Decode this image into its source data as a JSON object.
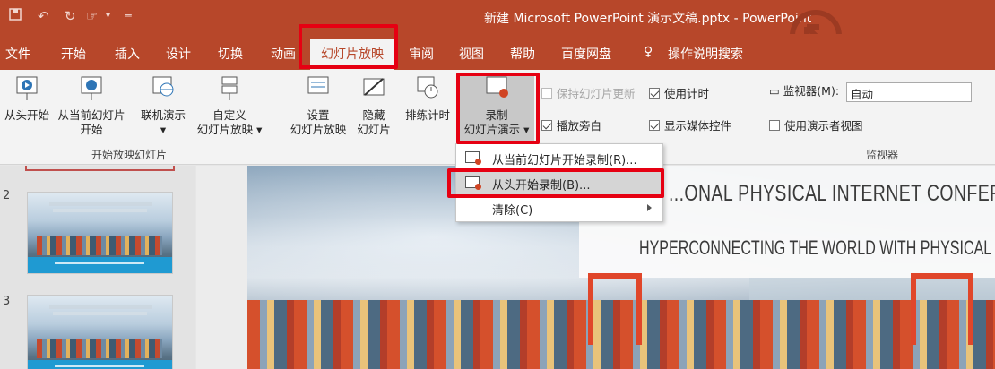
{
  "window": {
    "title": "新建 Microsoft PowerPoint 演示文稿.pptx  -  PowerPoint"
  },
  "quick_access": [
    "save-icon",
    "undo-icon",
    "redo-icon",
    "touch-mode-icon",
    "customize-icon"
  ],
  "tabs": [
    {
      "label": "文件"
    },
    {
      "label": "开始"
    },
    {
      "label": "插入"
    },
    {
      "label": "设计"
    },
    {
      "label": "切换"
    },
    {
      "label": "动画"
    },
    {
      "label": "幻灯片放映",
      "active": true
    },
    {
      "label": "审阅"
    },
    {
      "label": "视图"
    },
    {
      "label": "帮助"
    },
    {
      "label": "百度网盘"
    },
    {
      "label": "操作说明搜索"
    }
  ],
  "ribbon": {
    "group1": {
      "label": "开始放映幻灯片",
      "buttons": [
        {
          "line1": "从头开始",
          "line2": ""
        },
        {
          "line1": "从当前幻灯片",
          "line2": "开始"
        },
        {
          "line1": "联机演示",
          "line2": "▾"
        },
        {
          "line1": "自定义",
          "line2": "幻灯片放映 ▾"
        }
      ]
    },
    "group2": {
      "buttons": [
        {
          "line1": "设置",
          "line2": "幻灯片放映"
        },
        {
          "line1": "隐藏",
          "line2": "幻灯片"
        },
        {
          "line1": "排练计时",
          "line2": ""
        },
        {
          "line1": "录制",
          "line2": "幻灯片演示 ▾"
        }
      ],
      "checks": [
        {
          "label": "保持幻灯片更新",
          "checked": false,
          "disabled": true
        },
        {
          "label": "使用计时",
          "checked": true
        },
        {
          "label": "播放旁白",
          "checked": true
        },
        {
          "label": "显示媒体控件",
          "checked": true
        }
      ]
    },
    "monitor_group": {
      "label": "监视器",
      "monitor_label": "监视器(M):",
      "monitor_value": "自动",
      "presenter_view": "使用演示者视图"
    }
  },
  "dropdown": {
    "items": [
      {
        "label": "从当前幻灯片开始录制(R)..."
      },
      {
        "label": "从头开始录制(B)...",
        "highlighted": true
      },
      {
        "label": "清除(C)",
        "submenu": true
      }
    ]
  },
  "thumbnails": {
    "numbers": [
      "2",
      "3"
    ]
  },
  "slide": {
    "title": "...ONAL PHYSICAL INTERNET CONFERENCE",
    "subtitle": "HYPERCONNECTING THE WORLD WITH PHYSICAL INTERNET"
  },
  "colors": {
    "accent": "#b7472a",
    "highlight": "#e60012"
  }
}
